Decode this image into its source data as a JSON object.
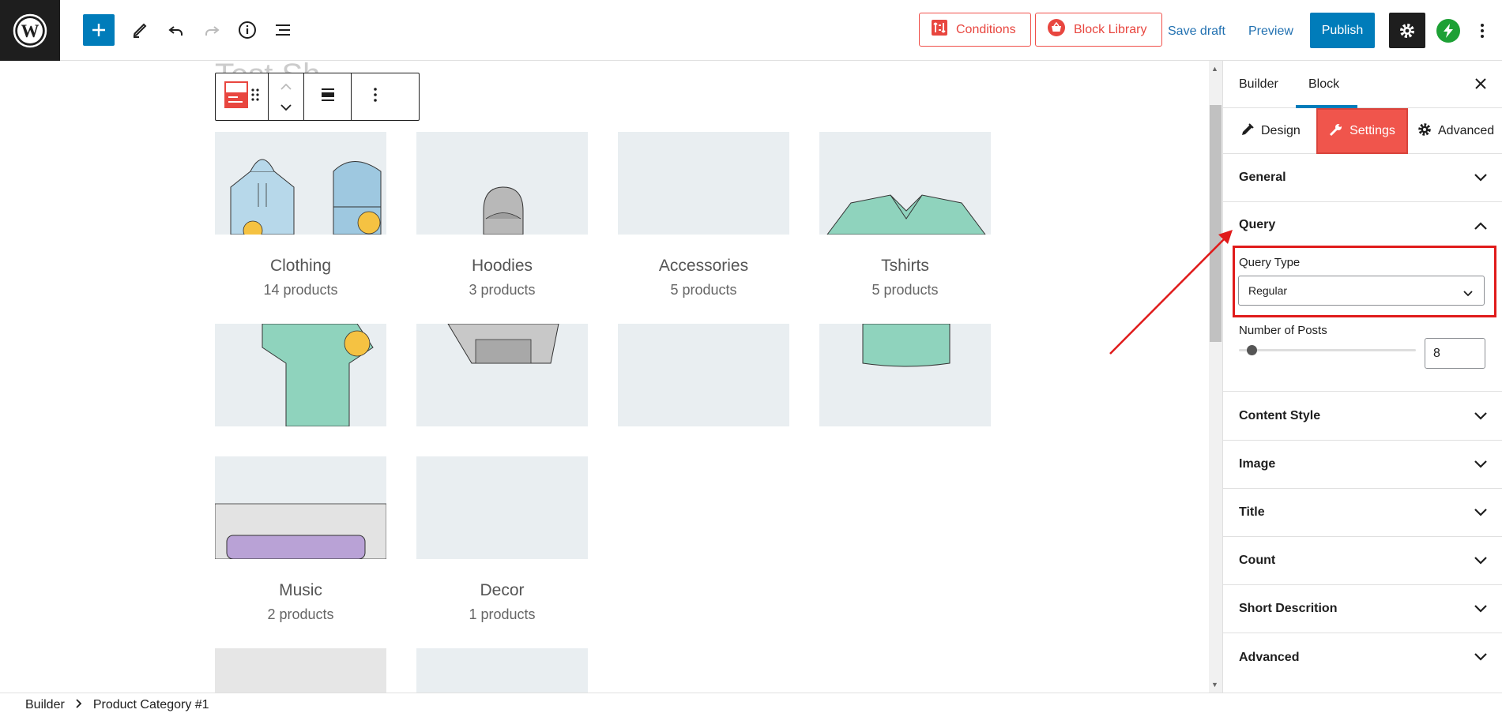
{
  "toolbar": {
    "conditions_label": "Conditions",
    "block_library_label": "Block Library",
    "save_draft_label": "Save draft",
    "preview_label": "Preview",
    "publish_label": "Publish",
    "colors": {
      "accent": "#007cba",
      "brand_red": "#f0504a",
      "dark": "#1e1e1e"
    }
  },
  "canvas": {
    "ghost_title": "Test Sh",
    "categories": [
      {
        "name": "Clothing",
        "count": "14 products"
      },
      {
        "name": "Hoodies",
        "count": "3 products"
      },
      {
        "name": "Accessories",
        "count": "5 products"
      },
      {
        "name": "Tshirts",
        "count": "5 products"
      },
      {
        "name": "Music",
        "count": "2 products"
      },
      {
        "name": "Decor",
        "count": "1 products"
      }
    ]
  },
  "sidebar": {
    "tabs": {
      "builder": "Builder",
      "block": "Block"
    },
    "sub_tabs": {
      "design": "Design",
      "settings": "Settings",
      "advanced": "Advanced"
    },
    "panels": {
      "general": "General",
      "query": "Query",
      "content_style": "Content Style",
      "image": "Image",
      "title": "Title",
      "count": "Count",
      "short_description": "Short Descrition",
      "advanced": "Advanced"
    },
    "query": {
      "type_label": "Query Type",
      "type_value": "Regular",
      "posts_label": "Number of Posts",
      "posts_value": "8"
    }
  },
  "footer": {
    "root": "Builder",
    "current": "Product Category #1"
  }
}
